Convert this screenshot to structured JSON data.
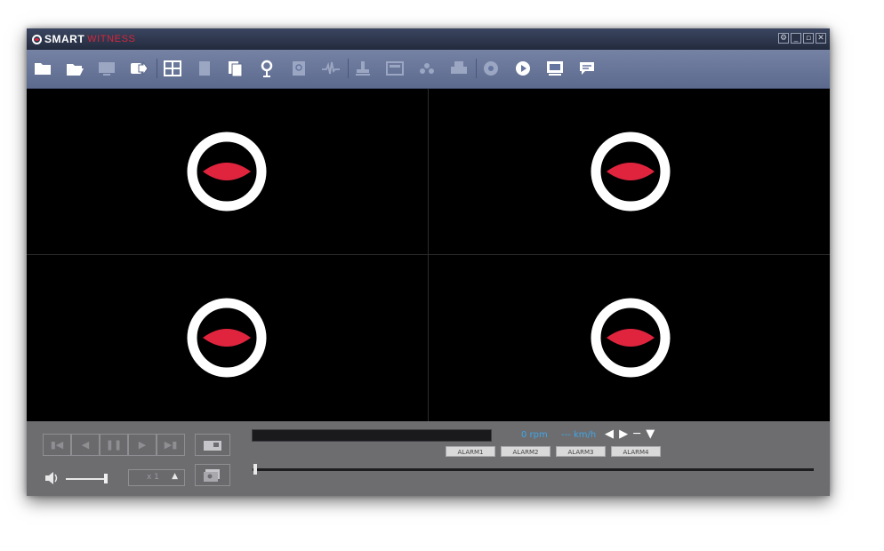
{
  "app": {
    "logo_primary": "SMART",
    "logo_secondary": "WITNESS",
    "window_controls": [
      "settings-icon",
      "minimize-icon",
      "restore-icon",
      "close-icon"
    ]
  },
  "toolbar": {
    "icons": [
      "folder-icon",
      "open-folder-icon",
      "monitor-icon",
      "export-icon",
      "grid-layout-icon",
      "document-icon",
      "copy-document-icon",
      "map-pin-icon",
      "search-document-icon",
      "waveform-icon",
      "stamp-icon",
      "screen-icon",
      "network-icon",
      "printer-icon",
      "record-icon",
      "play-icon",
      "display-icon",
      "chat-icon"
    ]
  },
  "video": {
    "channels": 4,
    "placeholder_icon": "no-signal-icon"
  },
  "controls": {
    "playback_icons": [
      "skip-back-icon",
      "step-back-icon",
      "pause-icon",
      "play-icon",
      "skip-forward-icon"
    ],
    "snapshot_icon": "camera-icon",
    "multi_icon": "gallery-icon",
    "volume_icon": "speaker-icon",
    "speed": "x 1",
    "rpm": "0 rpm",
    "speed_kmh": "--- km/h",
    "direction_glyphs": "◀ ▶ ─ ▼",
    "alarms": [
      "ALARM1",
      "ALARM2",
      "ALARM3",
      "ALARM4"
    ],
    "timeline_position": 0
  },
  "colors": {
    "toolbar": "#6674a0",
    "accent_red": "#e0243e",
    "accent_blue": "#3fa6e6",
    "panel": "#6d6d70"
  }
}
